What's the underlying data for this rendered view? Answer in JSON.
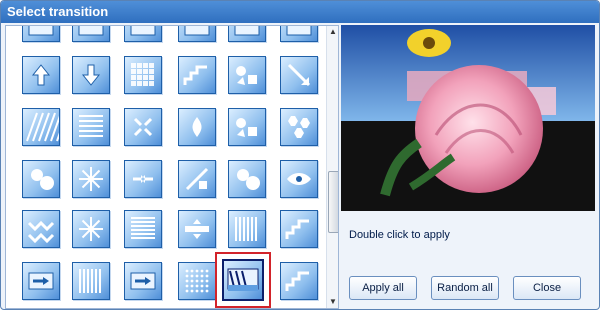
{
  "window": {
    "title": "Select transition"
  },
  "preview": {
    "hint": "Double click to apply"
  },
  "buttons": {
    "apply_all": "Apply all",
    "random_all": "Random all",
    "close": "Close"
  },
  "tiles": [
    [
      "partial-top-icon",
      "partial-top-icon",
      "partial-top-icon",
      "partial-top-icon",
      "partial-top-icon",
      "partial-top-icon"
    ],
    [
      "arrow-up-icon",
      "arrow-down-icon",
      "grid-cells-icon",
      "stairs-right-icon",
      "shapes-burst-icon",
      "arrow-diagonal-icon"
    ],
    [
      "diagonal-stripes-icon",
      "center-stripes-icon",
      "scatter-in-icon",
      "droplet-down-icon",
      "shapes-burst-icon",
      "hexagons-icon"
    ],
    [
      "circles-icon",
      "starburst-icon",
      "arrows-converge-icon",
      "shapes-diagonal-icon",
      "circles-icon",
      "eye-shape-icon"
    ],
    [
      "zigzag-icon",
      "starburst-icon",
      "horizontal-bars-icon",
      "split-horizontal-icon",
      "vertical-bars-icon",
      "stairs-right-icon"
    ],
    [
      "slide-arrows-icon",
      "vertical-bars-icon",
      "slide-arrows-icon",
      "dots-grid-icon",
      "diagonal-wipe-icon",
      "stairs-right-icon"
    ]
  ],
  "selected_tile": "diagonal-wipe-icon",
  "colors": {
    "title_bar": "#3f7fcf",
    "tile": "#8fbfee",
    "selection": "#d2232a"
  }
}
